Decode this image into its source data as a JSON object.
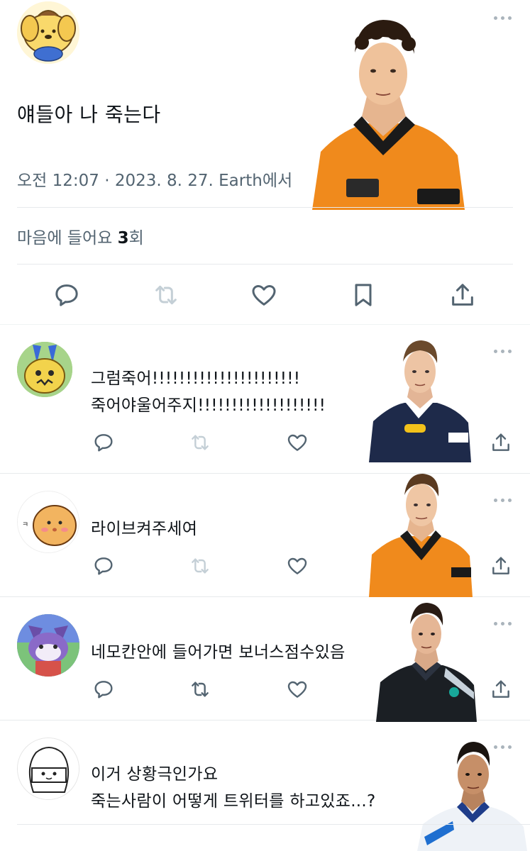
{
  "main_tweet": {
    "text": "얘들아 나 죽는다",
    "meta": "오전 12:07 · 2023. 8. 27. Earth에서",
    "likes_prefix": "마음에 들어요 ",
    "likes_count": "3",
    "likes_suffix": "회"
  },
  "replies": [
    {
      "lines": [
        "그럼죽어!!!!!!!!!!!!!!!!!!!!!!",
        "죽어야울어주지!!!!!!!!!!!!!!!!!!!"
      ],
      "retweet_active": false
    },
    {
      "lines": [
        "라이브켜주세여"
      ],
      "retweet_active": false
    },
    {
      "lines": [
        "네모칸안에 들어가면 보너스점수있음"
      ],
      "retweet_active": true
    },
    {
      "lines": [
        "이거 상황극인가요",
        "죽는사람이 어떻게 트위터를 하고있죠...?"
      ],
      "retweet_active": false
    }
  ],
  "colors": {
    "text": "#0f1419",
    "secondary": "#536471",
    "icon": "#536471",
    "icon_muted": "#c4cfd6",
    "divider": "#eff3f4",
    "mclaren_orange": "#f08a1c",
    "redbull_navy": "#1e2a4a",
    "mercedes_black": "#1b1f24",
    "williams_white": "#eef2f7"
  },
  "icons": [
    "reply-icon",
    "retweet-icon",
    "like-icon",
    "bookmark-icon",
    "share-icon",
    "more-icon"
  ]
}
